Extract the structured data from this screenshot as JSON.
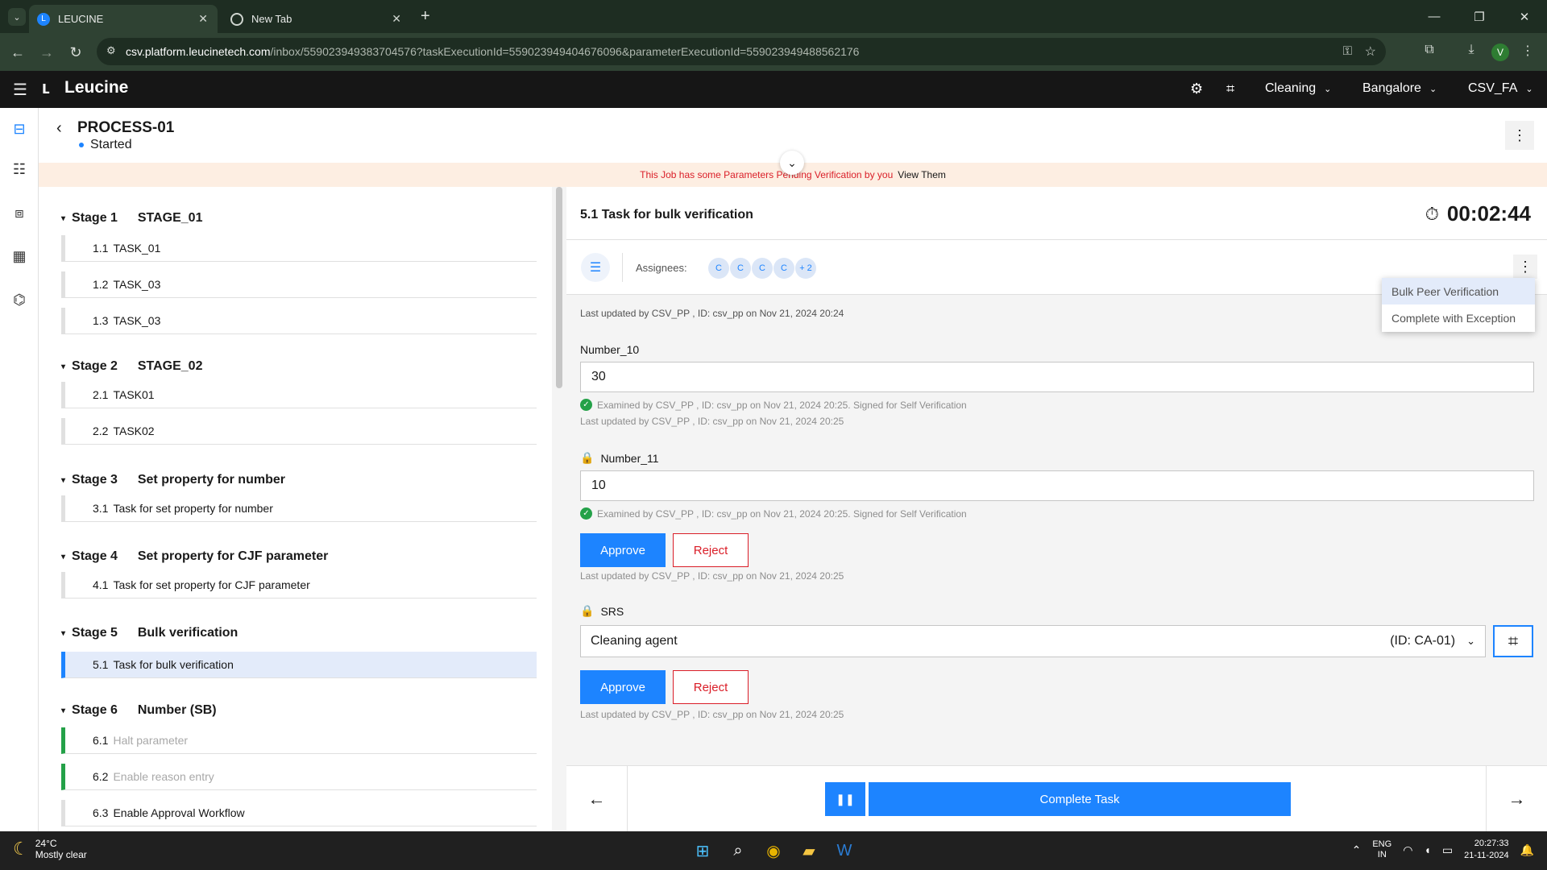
{
  "browser": {
    "tabs": [
      {
        "title": "LEUCINE",
        "active": true
      },
      {
        "title": "New Tab",
        "active": false
      }
    ],
    "url_host": "csv.platform.leucinetech.com",
    "url_path": "/inbox/559023949383704576?taskExecutionId=559023949404676096&parameterExecutionId=559023949488562176",
    "profile_initial": "V"
  },
  "header": {
    "logo_text": "Leucine",
    "facility": "Cleaning",
    "location": "Bangalore",
    "user": "CSV_FA"
  },
  "job": {
    "title": "PROCESS-01",
    "status": "Started",
    "banner_text": "This Job has some Parameters Pending Verification by you",
    "banner_link": "View Them"
  },
  "stages": [
    {
      "label": "Stage 1",
      "name": "STAGE_01"
    },
    {
      "label": "Stage 2",
      "name": "STAGE_02"
    },
    {
      "label": "Stage 3",
      "name": "Set property for number"
    },
    {
      "label": "Stage 4",
      "name": "Set property for CJF parameter"
    },
    {
      "label": "Stage 5",
      "name": "Bulk verification"
    },
    {
      "label": "Stage 6",
      "name": "Number (SB)"
    }
  ],
  "tasks": [
    {
      "num": "1.1",
      "name": "TASK_01"
    },
    {
      "num": "1.2",
      "name": "TASK_03"
    },
    {
      "num": "1.3",
      "name": "TASK_03"
    },
    {
      "num": "2.1",
      "name": "TASK01"
    },
    {
      "num": "2.2",
      "name": "TASK02"
    },
    {
      "num": "3.1",
      "name": "Task for set property for number"
    },
    {
      "num": "4.1",
      "name": "Task for set property for CJF parameter"
    },
    {
      "num": "5.1",
      "name": "Task for bulk verification"
    },
    {
      "num": "6.1",
      "name": "Halt parameter"
    },
    {
      "num": "6.2",
      "name": "Enable reason entry"
    },
    {
      "num": "6.3",
      "name": "Enable Approval Workflow"
    }
  ],
  "task": {
    "title": "5.1 Task for bulk verification",
    "timer": "00:02:44",
    "assignees_label": "Assignees:",
    "assignees": [
      "C",
      "C",
      "C",
      "C"
    ],
    "assignees_more": "+ 2",
    "last_updated": "Last updated by CSV_PP , ID: csv_pp on Nov 21, 2024 20:24",
    "menu": [
      "Bulk Peer Verification",
      "Complete with Exception"
    ]
  },
  "params": {
    "p1": {
      "label": "Number_10",
      "value": "30",
      "examined": "Examined by CSV_PP , ID: csv_pp on Nov 21, 2024 20:25. Signed for Self Verification",
      "updated": "Last updated by CSV_PP , ID: csv_pp on Nov 21, 2024 20:25"
    },
    "p2": {
      "label": "Number_11",
      "value": "10",
      "examined": "Examined by CSV_PP , ID: csv_pp on Nov 21, 2024 20:25. Signed for Self Verification",
      "updated": "Last updated by CSV_PP , ID: csv_pp on Nov 21, 2024 20:25"
    },
    "p3": {
      "label": "SRS",
      "value": "Cleaning agent",
      "value_id": "(ID: CA-01)",
      "updated": "Last updated by CSV_PP , ID: csv_pp on Nov 21, 2024 20:25"
    },
    "approve_label": "Approve",
    "reject_label": "Reject"
  },
  "footer": {
    "complete_label": "Complete Task"
  },
  "taskbar": {
    "temp": "24°C",
    "weather": "Mostly clear",
    "lang1": "ENG",
    "lang2": "IN",
    "time": "20:27:33",
    "date": "21-11-2024"
  },
  "colors": {
    "accent": "#1d84ff",
    "reject": "#da1e28",
    "success": "#24a148",
    "banner_bg": "#fdeee2"
  }
}
